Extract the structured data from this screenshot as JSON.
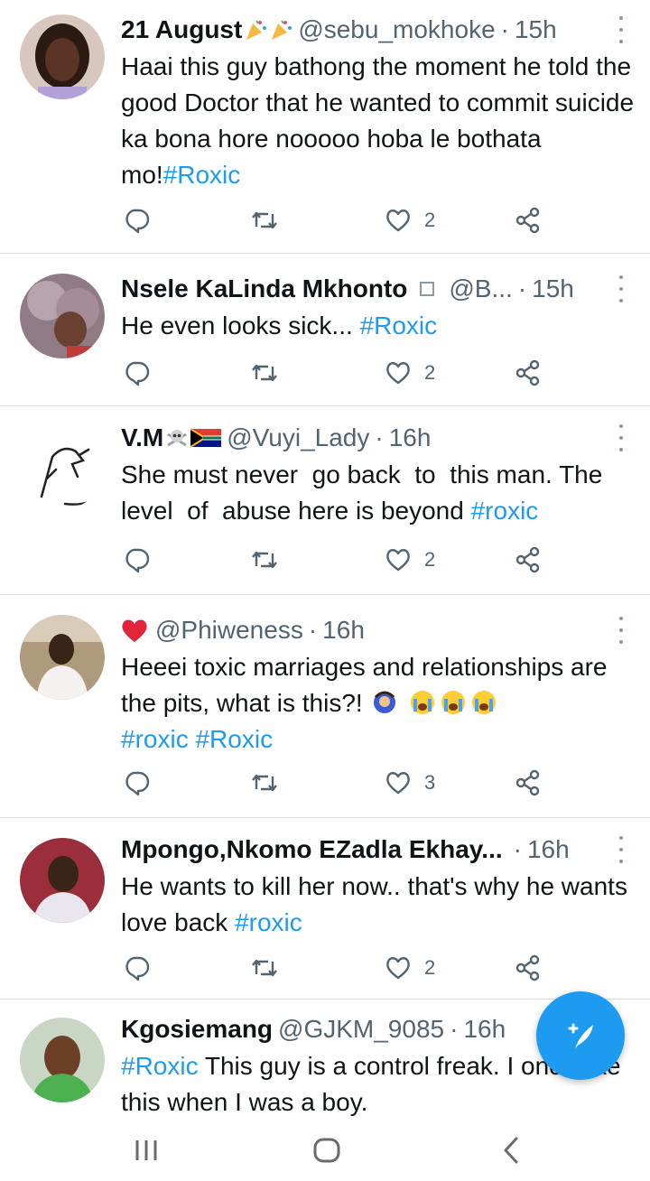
{
  "tweets": [
    {
      "name": "21 August",
      "handle": "@sebu_mokhoke",
      "time": "15h",
      "text": "Haai this guy bathong the moment he told the good Doctor that he wanted to commit suicide ka bona hore nooooo hoba le bothata mo!",
      "hashtags": [
        "#Roxic"
      ],
      "likes": "2"
    },
    {
      "name": "Nsele KaLinda Mkhonto",
      "handle": "@B...",
      "time": "15h",
      "text": "He even looks sick... ",
      "hashtags": [
        "#Roxic"
      ],
      "likes": "2"
    },
    {
      "name": "V.M",
      "handle": "@Vuyi_Lady",
      "time": "16h",
      "text": "She must never  go back  to  this man. The level  of  abuse here is beyond ",
      "hashtags": [
        "#roxic"
      ],
      "likes": "2"
    },
    {
      "name": "",
      "handle": "@Phiweness",
      "time": "16h",
      "text": "Heeei toxic marriages and relationships are the pits, what is this?!",
      "hashtags": [
        "#roxic",
        "#Roxic"
      ],
      "likes": "3"
    },
    {
      "name": "Mpongo,Nkomo EZadla Ekhay...",
      "handle": "",
      "time": "16h",
      "text": "He wants to kill her now.. that's why he wants love back ",
      "hashtags": [
        "#roxic"
      ],
      "likes": "2"
    },
    {
      "name": "Kgosiemang",
      "handle": "@GJKM_9085",
      "time": "16h",
      "text": " This guy is a control freak. I once like this when I was a boy.",
      "hashtags": [
        "#Roxic"
      ],
      "likes": ""
    }
  ],
  "icons": {
    "reply": "reply-icon",
    "retweet": "retweet-icon",
    "like": "like-icon",
    "share": "share-icon",
    "more": "more-options-icon",
    "compose": "compose-tweet-icon",
    "nav_recent": "recent-apps-icon",
    "nav_home": "home-nav-icon",
    "nav_back": "back-nav-icon"
  },
  "colors": {
    "accent": "#1d9bf0",
    "text": "#0f1419",
    "secondary": "#536471",
    "divider": "#d9dde1",
    "heart_emoji": "#e0243a"
  }
}
